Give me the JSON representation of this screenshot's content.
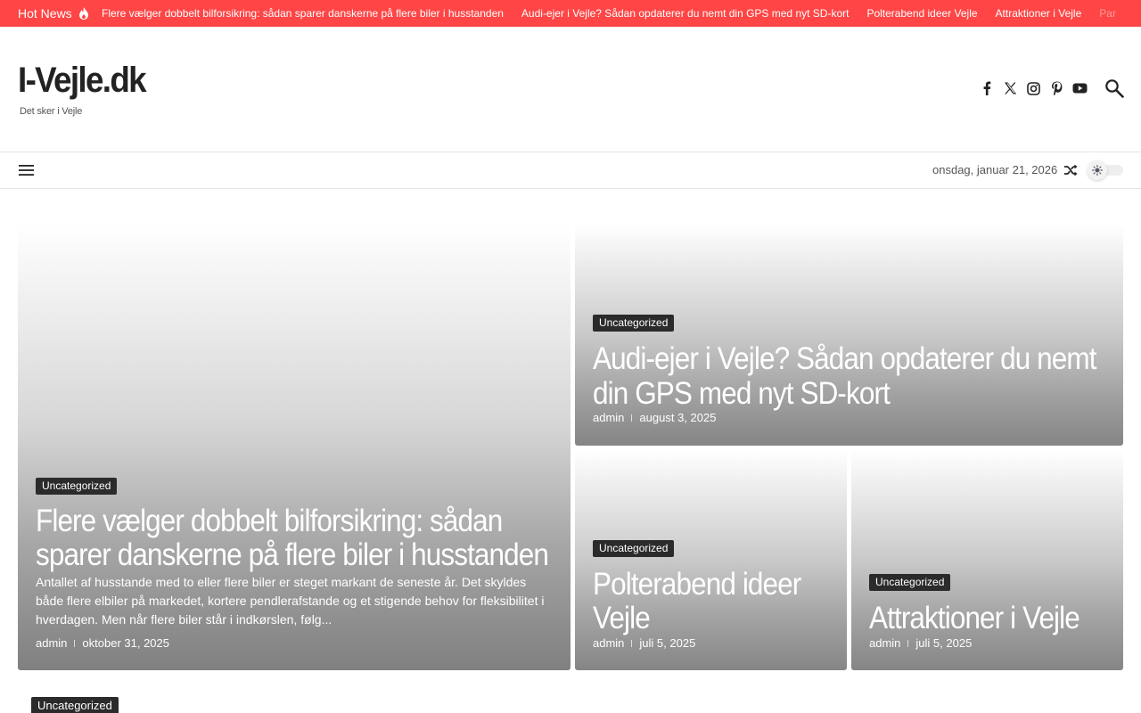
{
  "hotbar": {
    "label": "Hot News",
    "items": [
      "Flere vælger dobbelt bilforsikring: sådan sparer danskerne på flere biler i husstanden",
      "Audi-ejer i Vejle? Sådan opdaterer du nemt din GPS med nyt SD-kort",
      "Polterabend ideer Vejle",
      "Attraktioner i Vejle",
      "Par"
    ],
    "color": "#ff4545"
  },
  "header": {
    "logo": "I-Vejle.dk",
    "tagline": "Det sker i Vejle",
    "social_icons": [
      "facebook-icon",
      "x-twitter-icon",
      "instagram-icon",
      "pinterest-icon",
      "youtube-icon"
    ]
  },
  "navbar": {
    "date": "onsdag, januar 21, 2026"
  },
  "featured": {
    "big": {
      "category": "Uncategorized",
      "title": "Flere vælger dobbelt bilforsikring: sådan sparer danskerne på flere biler i husstanden",
      "excerpt": "Antallet af husstande med to eller flere biler er steget markant de seneste år. Det skyldes både flere elbiler på markedet, kortere pendlerafstande og et stigende behov for fleksibilitet i hverdagen. Men når flere biler står i indkørslen, følg...",
      "author": "admin",
      "date": "oktober 31, 2025"
    },
    "top": {
      "category": "Uncategorized",
      "title": "Audi-ejer i Vejle? Sådan opdaterer du nemt din GPS med nyt SD-kort",
      "author": "admin",
      "date": "august 3, 2025"
    },
    "small1": {
      "category": "Uncategorized",
      "title": "Polterabend ideer Vejle",
      "author": "admin",
      "date": "juli 5, 2025"
    },
    "small2": {
      "category": "Uncategorized",
      "title": "Attraktioner i Vejle",
      "author": "admin",
      "date": "juli 5, 2025"
    }
  },
  "bottom": {
    "category": "Uncategorized"
  }
}
